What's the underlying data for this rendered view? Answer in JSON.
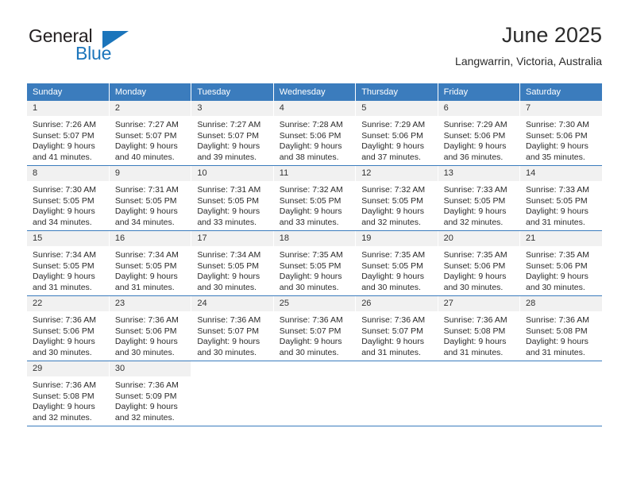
{
  "brand": {
    "name_part1": "General",
    "name_part2": "Blue",
    "triangle_icon": "triangle-icon",
    "colors": {
      "dark": "#231f20",
      "blue": "#1b75bb"
    }
  },
  "header": {
    "title": "June 2025",
    "subtitle": "Langwarrin, Victoria, Australia"
  },
  "theme": {
    "header_bg": "#3b7cbd",
    "header_text": "#ffffff",
    "daynum_bg": "#f1f1f1",
    "cell_bg": "#ffffff",
    "grid_line": "#3b7cbd"
  },
  "weekday_headers": [
    "Sunday",
    "Monday",
    "Tuesday",
    "Wednesday",
    "Thursday",
    "Friday",
    "Saturday"
  ],
  "weeks": [
    {
      "days": [
        {
          "num": "1",
          "sunrise": "Sunrise: 7:26 AM",
          "sunset": "Sunset: 5:07 PM",
          "daylight_line1": "Daylight: 9 hours",
          "daylight_line2": "and 41 minutes."
        },
        {
          "num": "2",
          "sunrise": "Sunrise: 7:27 AM",
          "sunset": "Sunset: 5:07 PM",
          "daylight_line1": "Daylight: 9 hours",
          "daylight_line2": "and 40 minutes."
        },
        {
          "num": "3",
          "sunrise": "Sunrise: 7:27 AM",
          "sunset": "Sunset: 5:07 PM",
          "daylight_line1": "Daylight: 9 hours",
          "daylight_line2": "and 39 minutes."
        },
        {
          "num": "4",
          "sunrise": "Sunrise: 7:28 AM",
          "sunset": "Sunset: 5:06 PM",
          "daylight_line1": "Daylight: 9 hours",
          "daylight_line2": "and 38 minutes."
        },
        {
          "num": "5",
          "sunrise": "Sunrise: 7:29 AM",
          "sunset": "Sunset: 5:06 PM",
          "daylight_line1": "Daylight: 9 hours",
          "daylight_line2": "and 37 minutes."
        },
        {
          "num": "6",
          "sunrise": "Sunrise: 7:29 AM",
          "sunset": "Sunset: 5:06 PM",
          "daylight_line1": "Daylight: 9 hours",
          "daylight_line2": "and 36 minutes."
        },
        {
          "num": "7",
          "sunrise": "Sunrise: 7:30 AM",
          "sunset": "Sunset: 5:06 PM",
          "daylight_line1": "Daylight: 9 hours",
          "daylight_line2": "and 35 minutes."
        }
      ]
    },
    {
      "days": [
        {
          "num": "8",
          "sunrise": "Sunrise: 7:30 AM",
          "sunset": "Sunset: 5:05 PM",
          "daylight_line1": "Daylight: 9 hours",
          "daylight_line2": "and 34 minutes."
        },
        {
          "num": "9",
          "sunrise": "Sunrise: 7:31 AM",
          "sunset": "Sunset: 5:05 PM",
          "daylight_line1": "Daylight: 9 hours",
          "daylight_line2": "and 34 minutes."
        },
        {
          "num": "10",
          "sunrise": "Sunrise: 7:31 AM",
          "sunset": "Sunset: 5:05 PM",
          "daylight_line1": "Daylight: 9 hours",
          "daylight_line2": "and 33 minutes."
        },
        {
          "num": "11",
          "sunrise": "Sunrise: 7:32 AM",
          "sunset": "Sunset: 5:05 PM",
          "daylight_line1": "Daylight: 9 hours",
          "daylight_line2": "and 33 minutes."
        },
        {
          "num": "12",
          "sunrise": "Sunrise: 7:32 AM",
          "sunset": "Sunset: 5:05 PM",
          "daylight_line1": "Daylight: 9 hours",
          "daylight_line2": "and 32 minutes."
        },
        {
          "num": "13",
          "sunrise": "Sunrise: 7:33 AM",
          "sunset": "Sunset: 5:05 PM",
          "daylight_line1": "Daylight: 9 hours",
          "daylight_line2": "and 32 minutes."
        },
        {
          "num": "14",
          "sunrise": "Sunrise: 7:33 AM",
          "sunset": "Sunset: 5:05 PM",
          "daylight_line1": "Daylight: 9 hours",
          "daylight_line2": "and 31 minutes."
        }
      ]
    },
    {
      "days": [
        {
          "num": "15",
          "sunrise": "Sunrise: 7:34 AM",
          "sunset": "Sunset: 5:05 PM",
          "daylight_line1": "Daylight: 9 hours",
          "daylight_line2": "and 31 minutes."
        },
        {
          "num": "16",
          "sunrise": "Sunrise: 7:34 AM",
          "sunset": "Sunset: 5:05 PM",
          "daylight_line1": "Daylight: 9 hours",
          "daylight_line2": "and 31 minutes."
        },
        {
          "num": "17",
          "sunrise": "Sunrise: 7:34 AM",
          "sunset": "Sunset: 5:05 PM",
          "daylight_line1": "Daylight: 9 hours",
          "daylight_line2": "and 30 minutes."
        },
        {
          "num": "18",
          "sunrise": "Sunrise: 7:35 AM",
          "sunset": "Sunset: 5:05 PM",
          "daylight_line1": "Daylight: 9 hours",
          "daylight_line2": "and 30 minutes."
        },
        {
          "num": "19",
          "sunrise": "Sunrise: 7:35 AM",
          "sunset": "Sunset: 5:05 PM",
          "daylight_line1": "Daylight: 9 hours",
          "daylight_line2": "and 30 minutes."
        },
        {
          "num": "20",
          "sunrise": "Sunrise: 7:35 AM",
          "sunset": "Sunset: 5:06 PM",
          "daylight_line1": "Daylight: 9 hours",
          "daylight_line2": "and 30 minutes."
        },
        {
          "num": "21",
          "sunrise": "Sunrise: 7:35 AM",
          "sunset": "Sunset: 5:06 PM",
          "daylight_line1": "Daylight: 9 hours",
          "daylight_line2": "and 30 minutes."
        }
      ]
    },
    {
      "days": [
        {
          "num": "22",
          "sunrise": "Sunrise: 7:36 AM",
          "sunset": "Sunset: 5:06 PM",
          "daylight_line1": "Daylight: 9 hours",
          "daylight_line2": "and 30 minutes."
        },
        {
          "num": "23",
          "sunrise": "Sunrise: 7:36 AM",
          "sunset": "Sunset: 5:06 PM",
          "daylight_line1": "Daylight: 9 hours",
          "daylight_line2": "and 30 minutes."
        },
        {
          "num": "24",
          "sunrise": "Sunrise: 7:36 AM",
          "sunset": "Sunset: 5:07 PM",
          "daylight_line1": "Daylight: 9 hours",
          "daylight_line2": "and 30 minutes."
        },
        {
          "num": "25",
          "sunrise": "Sunrise: 7:36 AM",
          "sunset": "Sunset: 5:07 PM",
          "daylight_line1": "Daylight: 9 hours",
          "daylight_line2": "and 30 minutes."
        },
        {
          "num": "26",
          "sunrise": "Sunrise: 7:36 AM",
          "sunset": "Sunset: 5:07 PM",
          "daylight_line1": "Daylight: 9 hours",
          "daylight_line2": "and 31 minutes."
        },
        {
          "num": "27",
          "sunrise": "Sunrise: 7:36 AM",
          "sunset": "Sunset: 5:08 PM",
          "daylight_line1": "Daylight: 9 hours",
          "daylight_line2": "and 31 minutes."
        },
        {
          "num": "28",
          "sunrise": "Sunrise: 7:36 AM",
          "sunset": "Sunset: 5:08 PM",
          "daylight_line1": "Daylight: 9 hours",
          "daylight_line2": "and 31 minutes."
        }
      ]
    },
    {
      "days": [
        {
          "num": "29",
          "sunrise": "Sunrise: 7:36 AM",
          "sunset": "Sunset: 5:08 PM",
          "daylight_line1": "Daylight: 9 hours",
          "daylight_line2": "and 32 minutes."
        },
        {
          "num": "30",
          "sunrise": "Sunrise: 7:36 AM",
          "sunset": "Sunset: 5:09 PM",
          "daylight_line1": "Daylight: 9 hours",
          "daylight_line2": "and 32 minutes."
        },
        {
          "num": "",
          "sunrise": "",
          "sunset": "",
          "daylight_line1": "",
          "daylight_line2": ""
        },
        {
          "num": "",
          "sunrise": "",
          "sunset": "",
          "daylight_line1": "",
          "daylight_line2": ""
        },
        {
          "num": "",
          "sunrise": "",
          "sunset": "",
          "daylight_line1": "",
          "daylight_line2": ""
        },
        {
          "num": "",
          "sunrise": "",
          "sunset": "",
          "daylight_line1": "",
          "daylight_line2": ""
        },
        {
          "num": "",
          "sunrise": "",
          "sunset": "",
          "daylight_line1": "",
          "daylight_line2": ""
        }
      ]
    }
  ]
}
